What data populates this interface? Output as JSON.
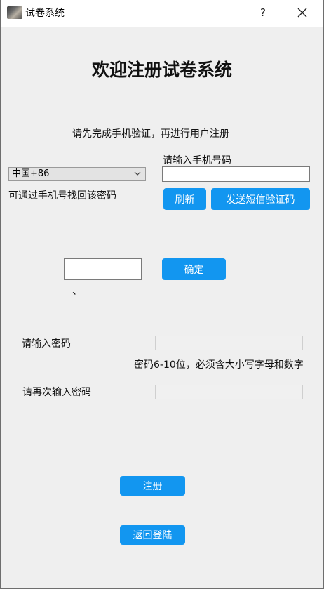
{
  "window": {
    "title": "试卷系统",
    "help_label": "?"
  },
  "page": {
    "heading": "欢迎注册试卷系统",
    "instruction": "请先完成手机验证，再进行用户注册"
  },
  "phone": {
    "label": "请输入手机号码",
    "country_code": "中国+86",
    "recover_note": "可通过手机号找回该密码",
    "value": ""
  },
  "buttons": {
    "refresh": "刷新",
    "send_code": "发送短信验证码",
    "confirm": "确定",
    "register": "注册",
    "back_login": "返回登陆"
  },
  "code": {
    "value": "",
    "stray_mark": "、"
  },
  "password": {
    "label": "请输入密码",
    "hint": "密码6-10位，必须含大小写字母和数字",
    "confirm_label": "请再次输入密码"
  },
  "colors": {
    "accent": "#1296f0",
    "background": "#efefef"
  }
}
